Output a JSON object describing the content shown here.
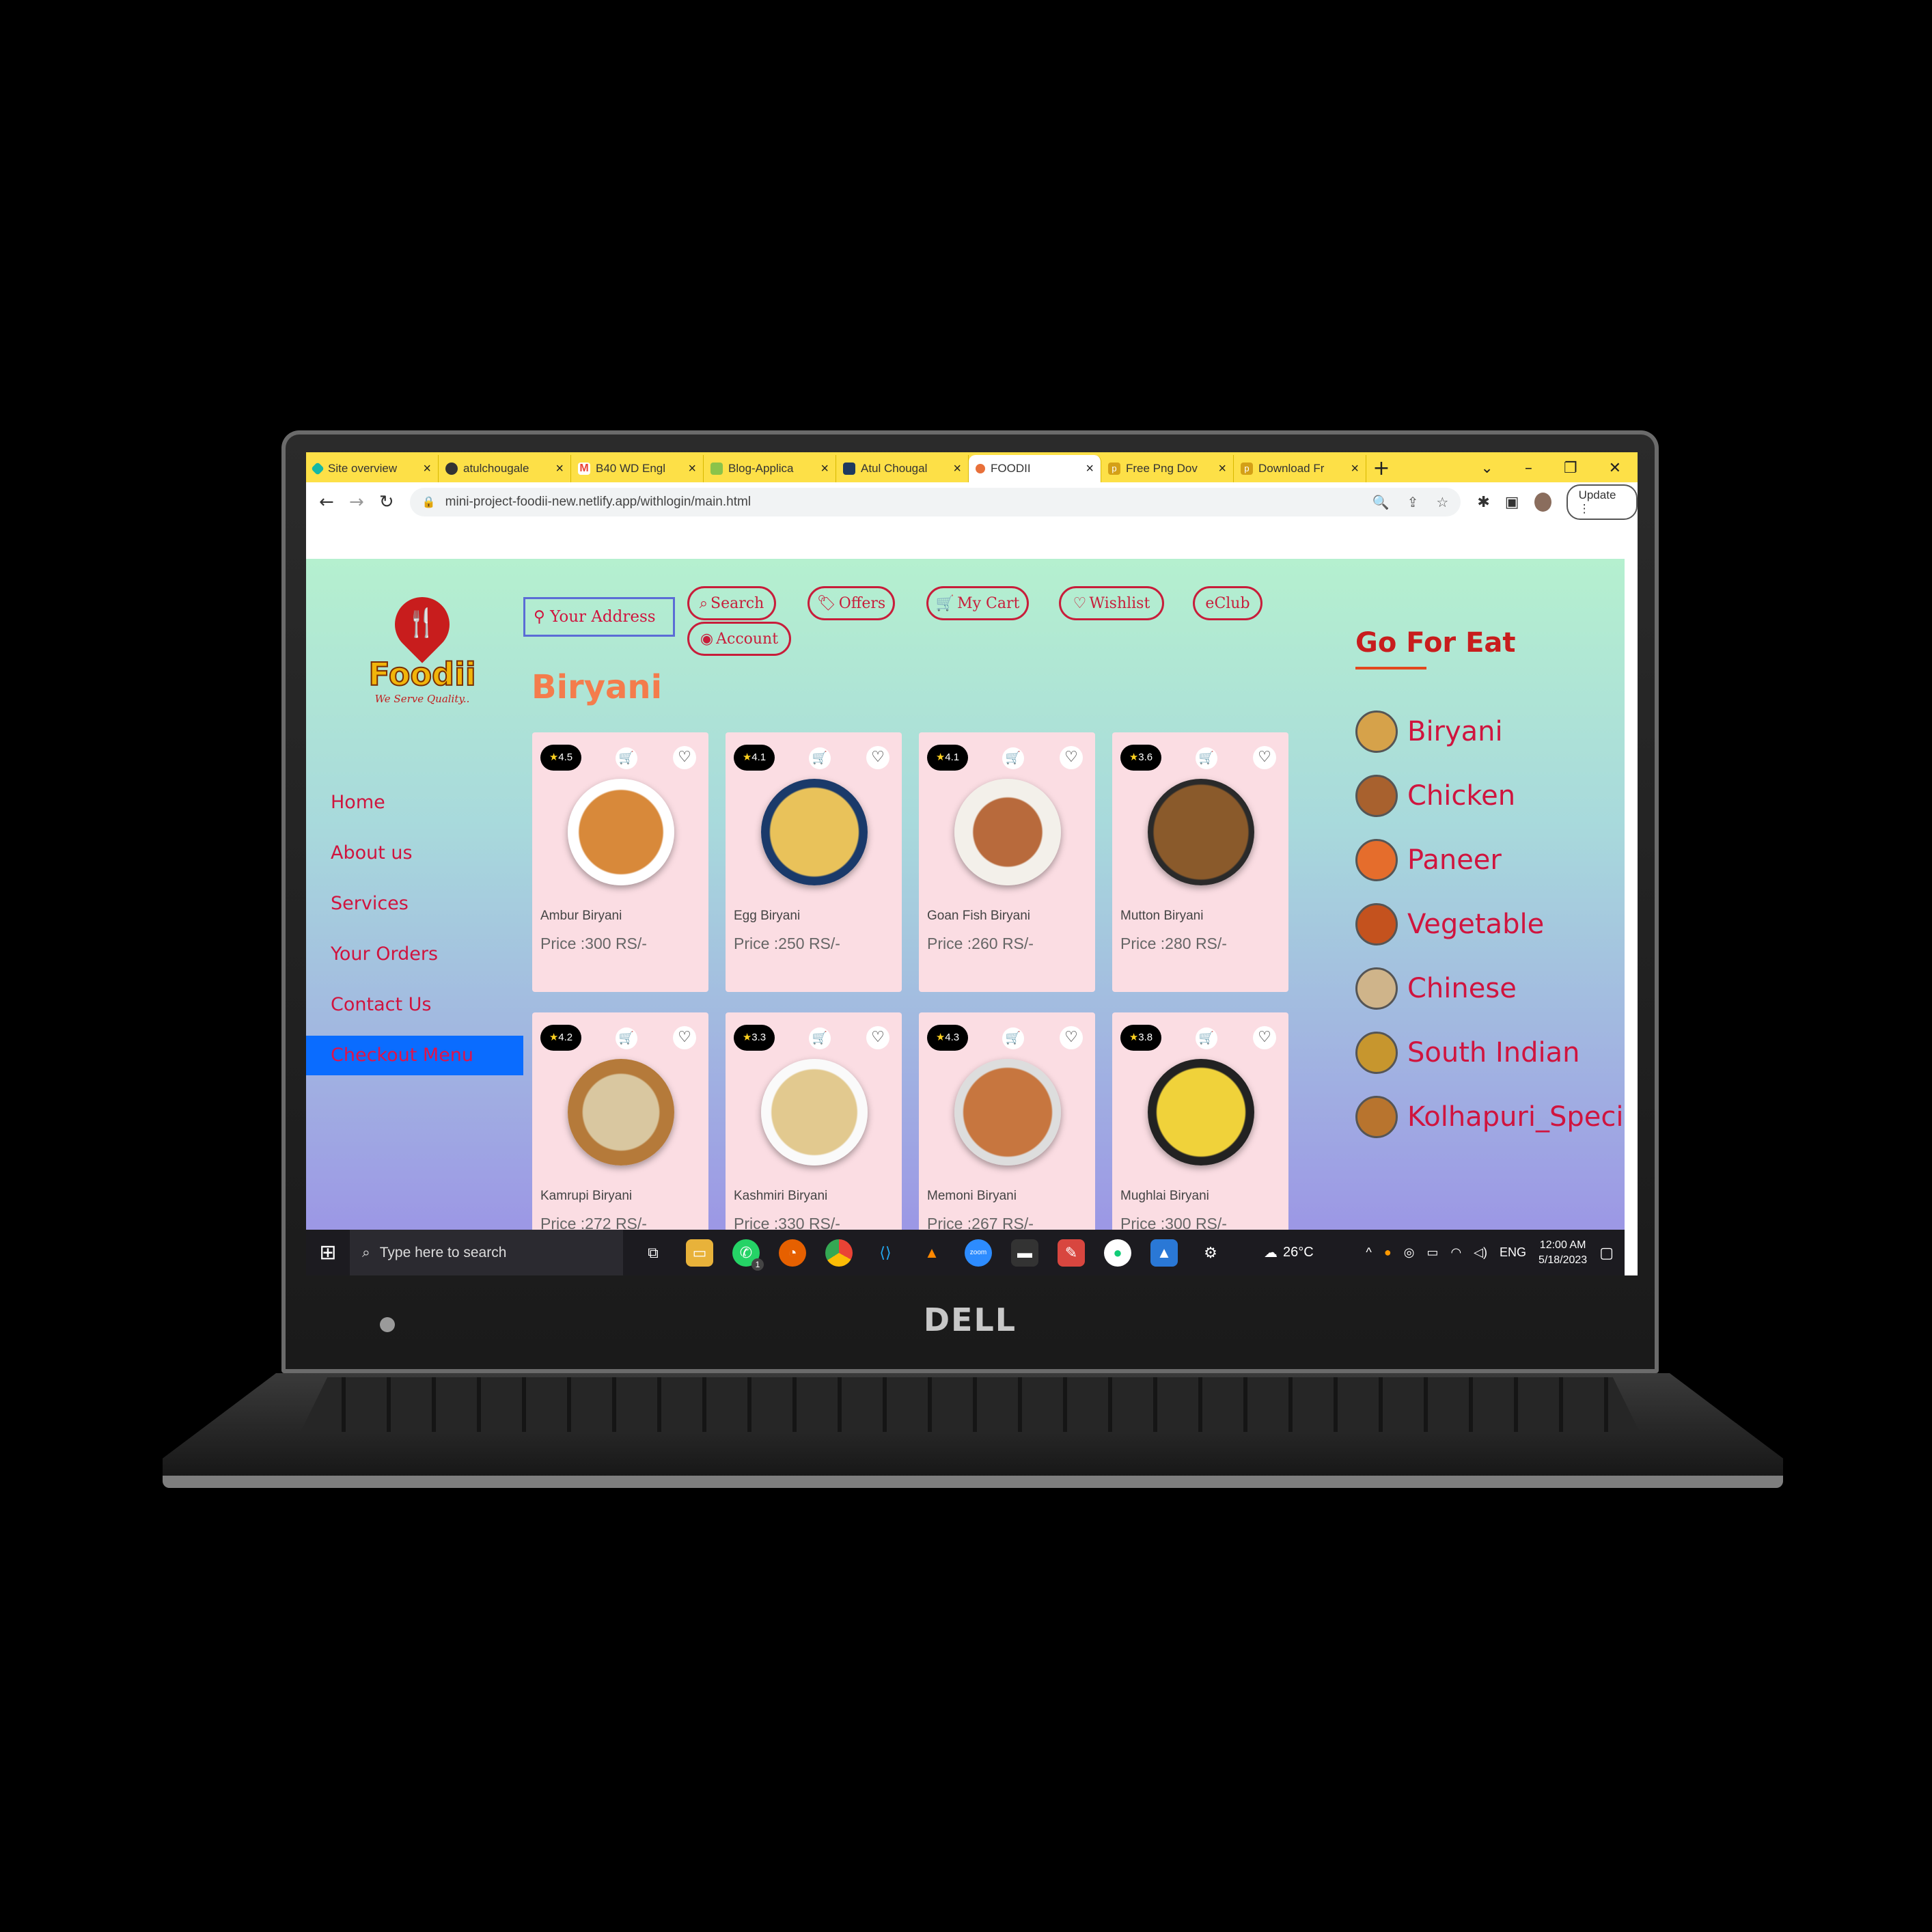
{
  "browser": {
    "tabs": [
      {
        "label": "Site overview",
        "color": "#14b8a6",
        "active": false
      },
      {
        "label": "atulchougale",
        "color": "#333333",
        "active": false
      },
      {
        "label": "B40 WD Engl",
        "color": "#ea4335",
        "active": false
      },
      {
        "label": "Blog-Applica",
        "color": "#8bc34a",
        "active": false
      },
      {
        "label": "Atul Chougal",
        "color": "#1e3a5f",
        "active": false
      },
      {
        "label": "FOODII",
        "color": "#e8703a",
        "active": true
      },
      {
        "label": "Free Png Dov",
        "color": "#d4a017",
        "active": false
      },
      {
        "label": "Download Fr",
        "color": "#d4a017",
        "active": false
      }
    ],
    "url": "mini-project-foodii-new.netlify.app/withlogin/main.html",
    "update_label": "Update"
  },
  "logo": {
    "name": "Foodii",
    "tagline": "We Serve Quality.."
  },
  "sidenav": [
    {
      "label": "Home",
      "active": false
    },
    {
      "label": "About us",
      "active": false
    },
    {
      "label": "Services",
      "active": false
    },
    {
      "label": "Your Orders",
      "active": false
    },
    {
      "label": "Contact Us",
      "active": false
    },
    {
      "label": "Checkout Menu",
      "active": true
    }
  ],
  "header": {
    "address_placeholder": "Your Address",
    "buttons": {
      "search": "Search",
      "offers": "Offers",
      "cart": "My Cart",
      "wishlist": "Wishlist",
      "eclub": "eClub",
      "account": "Account"
    }
  },
  "section_title": "Biryani",
  "foods": [
    {
      "name": "Ambur Biryani",
      "price": "Price :300 RS/-",
      "rating": "4.5",
      "color": "#d8893a"
    },
    {
      "name": "Egg Biryani",
      "price": "Price :250 RS/-",
      "rating": "4.1",
      "color": "#e9c25a"
    },
    {
      "name": "Goan Fish Biryani",
      "price": "Price :260 RS/-",
      "rating": "4.1",
      "color": "#b86a3c"
    },
    {
      "name": "Mutton Biryani",
      "price": "Price :280 RS/-",
      "rating": "3.6",
      "color": "#8a5a2b"
    },
    {
      "name": "Kamrupi Biryani",
      "price": "Price :272 RS/-",
      "rating": "4.2",
      "color": "#d9c7a0"
    },
    {
      "name": "Kashmiri Biryani",
      "price": "Price :330 RS/-",
      "rating": "3.3",
      "color": "#e2c98f"
    },
    {
      "name": "Memoni Biryani",
      "price": "Price :267 RS/-",
      "rating": "4.3",
      "color": "#c7763f"
    },
    {
      "name": "Mughlai Biryani",
      "price": "Price :300 RS/-",
      "rating": "3.8",
      "color": "#f0d23a"
    }
  ],
  "go_for_eat": {
    "title": "Go For Eat",
    "categories": [
      {
        "label": "Biryani",
        "color": "#d6a24a"
      },
      {
        "label": "Chicken",
        "color": "#a8612e"
      },
      {
        "label": "Paneer",
        "color": "#e56d2c"
      },
      {
        "label": "Vegetable",
        "color": "#c4521e"
      },
      {
        "label": "Chinese",
        "color": "#cfb48a"
      },
      {
        "label": "South Indian",
        "color": "#c7962e"
      },
      {
        "label": "Kolhapuri_Specia",
        "color": "#b8742e"
      }
    ]
  },
  "taskbar": {
    "search_placeholder": "Type here to search",
    "weather": "26°C",
    "language": "ENG",
    "time": "12:00 AM",
    "date": "5/18/2023",
    "whatsapp_badge": "1"
  },
  "laptop_brand": "DELL",
  "icons": [
    "search-icon",
    "map-pin-icon",
    "tag-icon",
    "cart-icon",
    "heart-icon",
    "user-icon",
    "star-icon",
    "windows-icon"
  ]
}
